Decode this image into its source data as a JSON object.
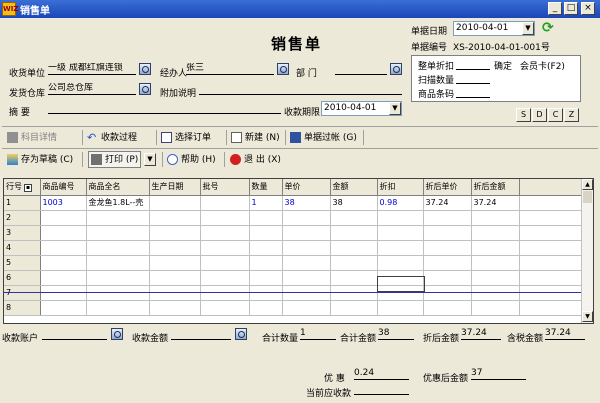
{
  "window": {
    "title": "销售单",
    "app_icon_text": "WIZ"
  },
  "form_title": "销售单",
  "header": {
    "doc_date_label": "单据日期",
    "doc_date_value": "2010-04-01",
    "doc_no_label": "单据编号",
    "doc_no_value": "XS-2010-04-01-001号",
    "customer_label": "收货单位",
    "customer_value": "一级 成都红旗连锁",
    "handler_label": "经办人",
    "handler_value": "张三",
    "dept_label": "部  门",
    "dept_value": "",
    "warehouse_label": "发货仓库",
    "warehouse_value": "公司总仓库",
    "note_label": "附加说明",
    "note_value": "",
    "summary_label": "摘    要",
    "summary_value": "",
    "due_label": "收款期限",
    "due_value": "2010-04-01"
  },
  "discount_panel": {
    "whole_discount_label": "整单折扣",
    "confirm_label": "确定",
    "member_card_label": "会员卡(F2)",
    "scan_qty_label": "扫描数量",
    "barcode_label": "商品条码"
  },
  "sdcz_buttons": [
    "S",
    "D",
    "C",
    "Z"
  ],
  "toolbar1": [
    {
      "label": "科目详情",
      "icon": "list-icon",
      "disabled": true
    },
    {
      "label": "收款过程",
      "icon": "undo-icon"
    },
    {
      "label": "选择订单",
      "icon": "table-icon"
    },
    {
      "label": "新建 (N)",
      "icon": "new-doc-icon"
    },
    {
      "label": "单据过帐 (G)",
      "icon": "post-icon"
    }
  ],
  "toolbar2": [
    {
      "label": "存为草稿 (C)",
      "icon": "save-draft-icon"
    },
    {
      "label": "打印 (P)",
      "icon": "printer-icon"
    },
    {
      "label": "帮助 (H)",
      "icon": "help-icon"
    },
    {
      "label": "退 出 (X)",
      "icon": "exit-icon"
    }
  ],
  "grid": {
    "columns": [
      "行号",
      "商品编号",
      "商品全名",
      "生产日期",
      "批号",
      "数量",
      "单价",
      "金额",
      "折扣",
      "折后单价",
      "折后金额"
    ],
    "rows": [
      [
        "1",
        "1003",
        "金龙鱼1.8L--壳",
        "",
        "",
        "1",
        "38",
        "38",
        "0.98",
        "37.24",
        "37.24"
      ],
      [
        "2",
        "",
        "",
        "",
        "",
        "",
        "",
        "",
        "",
        "",
        ""
      ],
      [
        "3",
        "",
        "",
        "",
        "",
        "",
        "",
        "",
        "",
        "",
        ""
      ],
      [
        "4",
        "",
        "",
        "",
        "",
        "",
        "",
        "",
        "",
        "",
        ""
      ],
      [
        "5",
        "",
        "",
        "",
        "",
        "",
        "",
        "",
        "",
        "",
        ""
      ],
      [
        "6",
        "",
        "",
        "",
        "",
        "",
        "",
        "",
        "",
        "",
        ""
      ],
      [
        "7",
        "",
        "",
        "",
        "",
        "",
        "",
        "",
        "",
        "",
        ""
      ],
      [
        "8",
        "",
        "",
        "",
        "",
        "",
        "",
        "",
        "",
        "",
        ""
      ]
    ]
  },
  "footer": {
    "account_label": "收款账户",
    "account_value": "",
    "amount_label": "收款金额",
    "amount_value": "",
    "total_qty_label": "合计数量",
    "total_qty_value": "1",
    "total_amount_label": "合计金额",
    "total_amount_value": "38",
    "discounted_total_label": "折后金额",
    "discounted_total_value": "37.24",
    "tax_total_label": "含税金额",
    "tax_total_value": "37.24",
    "discount_label": "优  惠",
    "discount_value": "0.24",
    "after_discount_label": "优惠后金额",
    "after_discount_value": "37",
    "receivable_label": "当前应收款",
    "receivable_value": ""
  },
  "colors": {
    "title_bar": "#1A46B8",
    "window_bg": "#ECE9D8",
    "link_blue": "#0000CC",
    "grid_highlight_line": "#3030A0"
  }
}
